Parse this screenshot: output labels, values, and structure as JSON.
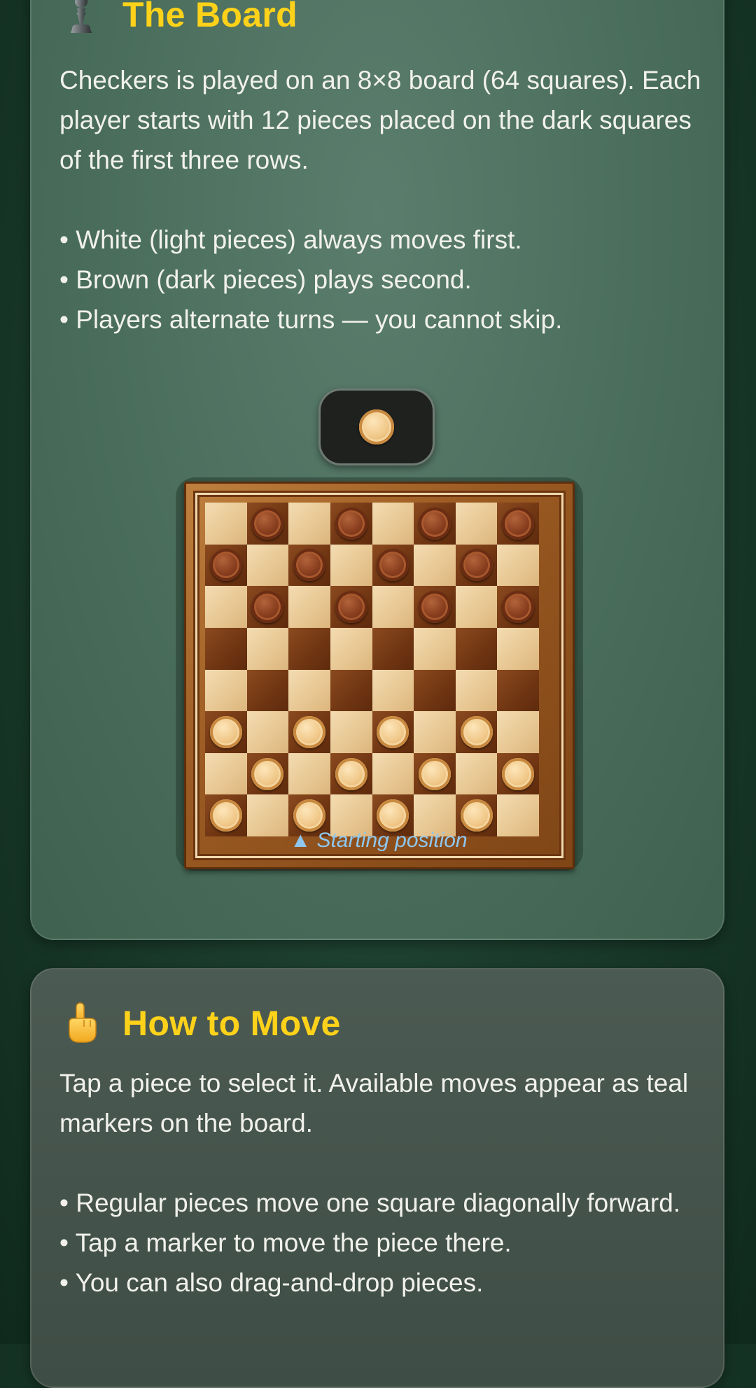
{
  "board_card": {
    "icon": "pawn-icon",
    "title": "The Board",
    "paragraph": "Checkers is played on an 8×8 board (64 squares). Each player starts with 12 pieces placed on the dark squares of the first three rows.",
    "bullets": [
      "• White (light pieces) always moves first.",
      "• Brown (dark pieces) plays second.",
      "• Players alternate turns — you cannot skip."
    ],
    "turn_indicator": "light-piece",
    "board": {
      "rows": [
        [
          "",
          "b",
          "",
          "b",
          "",
          "b",
          "",
          "b"
        ],
        [
          "b",
          "",
          "b",
          "",
          "b",
          "",
          "b",
          ""
        ],
        [
          "",
          "b",
          "",
          "b",
          "",
          "b",
          "",
          "b"
        ],
        [
          "",
          "",
          "",
          "",
          "",
          "",
          "",
          ""
        ],
        [
          "",
          "",
          "",
          "",
          "",
          "",
          "",
          ""
        ],
        [
          "w",
          "",
          "w",
          "",
          "w",
          "",
          "w",
          ""
        ],
        [
          "",
          "w",
          "",
          "w",
          "",
          "w",
          "",
          "w"
        ],
        [
          "w",
          "",
          "w",
          "",
          "w",
          "",
          "w",
          ""
        ]
      ]
    },
    "caption": "▲ Starting position"
  },
  "move_card": {
    "icon": "pointing-hand-icon",
    "title": "How to Move",
    "paragraph": "Tap a piece to select it. Available moves appear as teal markers on the board.",
    "bullets": [
      "• Regular pieces move one square diagonally forward.",
      "• Tap a marker to move the piece there.",
      "• You can also drag-and-drop pieces."
    ]
  },
  "colors": {
    "title": "#ffd21a",
    "caption": "#8fc7ef",
    "text": "#f1f1ec"
  }
}
